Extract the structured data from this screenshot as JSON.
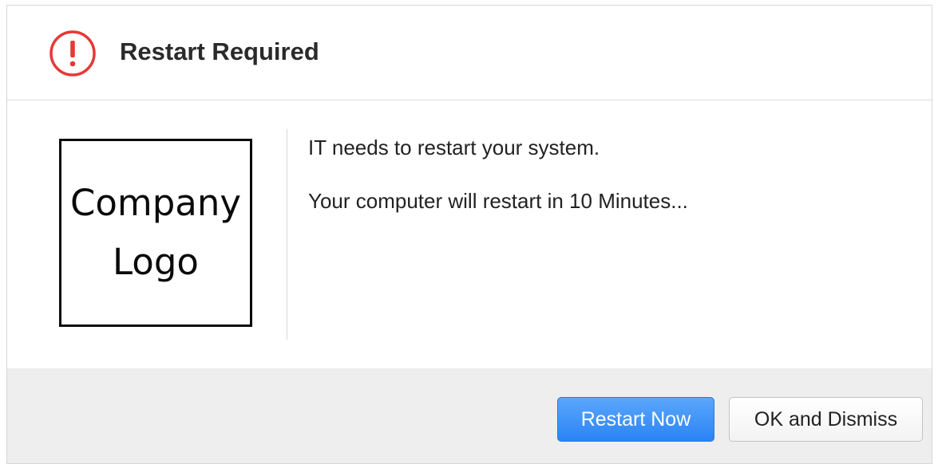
{
  "dialog": {
    "title": "Restart Required",
    "alert_icon": "exclamation-circle-icon",
    "alert_color": "#e53935"
  },
  "logo": {
    "line1": "Company",
    "line2": "Logo"
  },
  "message": {
    "line1": "IT needs to restart your system.",
    "line2": "Your computer will restart in 10 Minutes..."
  },
  "buttons": {
    "restart_label": "Restart Now",
    "dismiss_label": "OK and Dismiss"
  },
  "colors": {
    "primary_button": "#2b84f5",
    "footer_background": "#eeeeee"
  }
}
